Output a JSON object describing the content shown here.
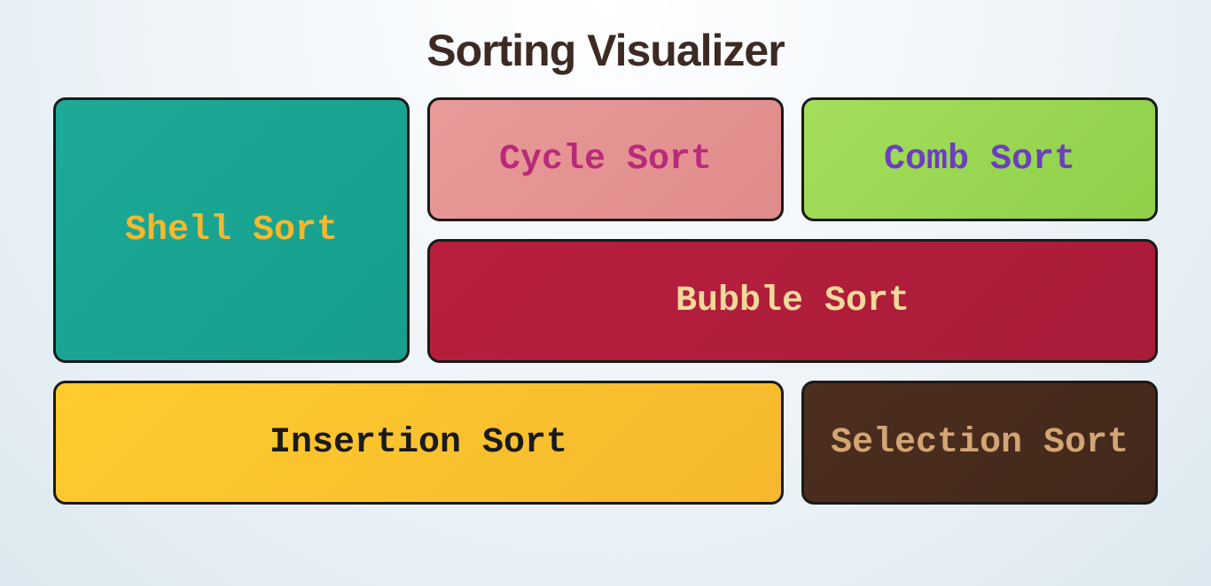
{
  "title": "Sorting Visualizer",
  "cards": {
    "shell": {
      "label": "Shell Sort"
    },
    "cycle": {
      "label": "Cycle Sort"
    },
    "comb": {
      "label": "Comb Sort"
    },
    "bubble": {
      "label": "Bubble Sort"
    },
    "insertion": {
      "label": "Insertion Sort"
    },
    "selection": {
      "label": "Selection Sort"
    }
  }
}
